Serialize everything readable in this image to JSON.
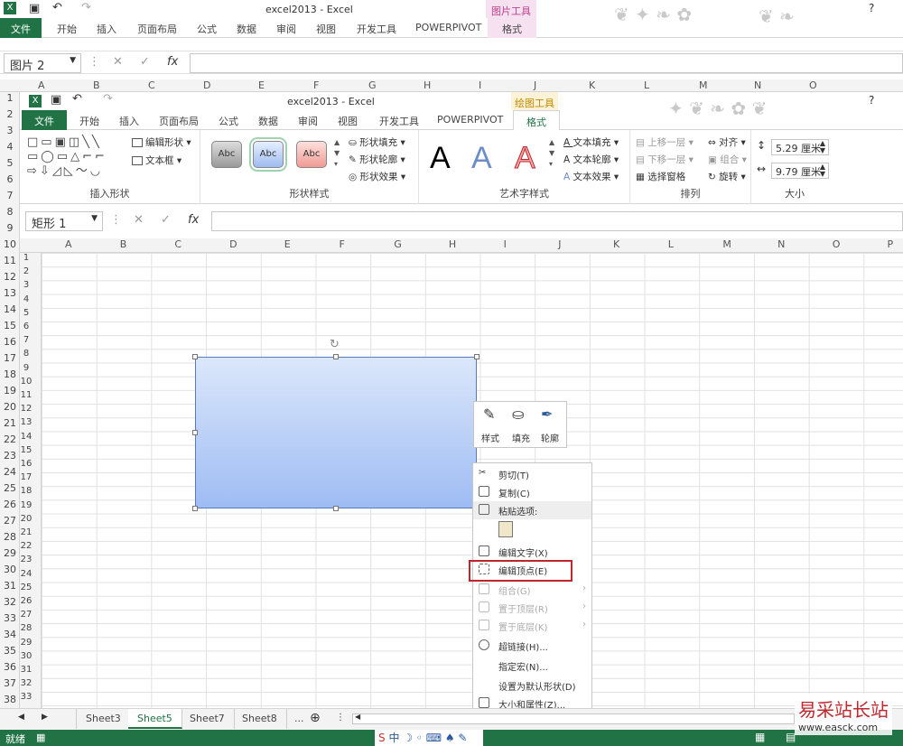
{
  "outer": {
    "title": "excel2013 - Excel",
    "tool_title": "图片工具",
    "help": "?",
    "tabs": [
      "文件",
      "开始",
      "插入",
      "页面布局",
      "公式",
      "数据",
      "审阅",
      "视图",
      "开发工具",
      "POWERPIVOT",
      "格式"
    ],
    "namebox": "图片 2",
    "fx": "fx",
    "cols": [
      "A",
      "B",
      "C",
      "D",
      "E",
      "F",
      "G",
      "H",
      "I",
      "J",
      "K",
      "L",
      "M",
      "N",
      "O"
    ],
    "rows": [
      "1",
      "2",
      "3",
      "4",
      "5",
      "6",
      "7",
      "8",
      "9",
      "10",
      "11",
      "12",
      "13",
      "14",
      "15",
      "16",
      "17",
      "18",
      "19",
      "20",
      "21",
      "22",
      "23",
      "24",
      "25",
      "26",
      "27",
      "28",
      "29",
      "30",
      "31",
      "32",
      "33",
      "34",
      "35",
      "36",
      "37",
      "38"
    ]
  },
  "inner": {
    "title": "excel2013 - Excel",
    "tool_title": "绘图工具",
    "tabs": [
      "文件",
      "开始",
      "插入",
      "页面布局",
      "公式",
      "数据",
      "审阅",
      "视图",
      "开发工具",
      "POWERPIVOT",
      "格式"
    ],
    "groups": {
      "insert_shape": "插入形状",
      "shape_style": "形状样式",
      "art_style": "艺术字样式",
      "arrange": "排列",
      "size": "大小"
    },
    "edit_shape": "编辑形状",
    "textbox": "文本框",
    "abc": "Abc",
    "shape_fill": "形状填充",
    "shape_outline": "形状轮廓",
    "shape_effect": "形状效果",
    "text_fill": "文本填充",
    "text_outline": "文本轮廓",
    "text_effect": "文本效果",
    "bring_forward": "上移一层",
    "send_backward": "下移一层",
    "selection_pane": "选择窗格",
    "align": "对齐",
    "group": "组合",
    "rotate": "旋转",
    "height": "5.29 厘米",
    "width": "9.79 厘米",
    "bigA": "A",
    "namebox": "矩形 1",
    "fx": "fx",
    "cols": [
      "A",
      "B",
      "C",
      "D",
      "E",
      "F",
      "G",
      "H",
      "I",
      "J",
      "K",
      "L",
      "M",
      "N",
      "O",
      "P"
    ],
    "rows": [
      "1",
      "2",
      "3",
      "4",
      "5",
      "6",
      "7",
      "8",
      "9",
      "10",
      "11",
      "12",
      "13",
      "14",
      "15",
      "16",
      "17",
      "18",
      "19",
      "20",
      "21",
      "22",
      "23",
      "24",
      "25",
      "26",
      "27",
      "28",
      "29",
      "30",
      "31",
      "32",
      "33"
    ]
  },
  "mini_toolbar": {
    "style": "样式",
    "fill": "填充",
    "outline": "轮廓"
  },
  "context_menu": [
    "剪切(T)",
    "复制(C)",
    "粘贴选项:",
    "编辑文字(X)",
    "编辑顶点(E)",
    "组合(G)",
    "置于顶层(R)",
    "置于底层(K)",
    "超链接(H)...",
    "指定宏(N)...",
    "设置为默认形状(D)",
    "大小和属性(Z)..."
  ],
  "sheets": [
    "Sheet3",
    "Sheet5",
    "Sheet7",
    "Sheet8",
    "..."
  ],
  "status": "就绪",
  "watermark": {
    "cn": "易采站长站",
    "url": "www.easck.com"
  }
}
